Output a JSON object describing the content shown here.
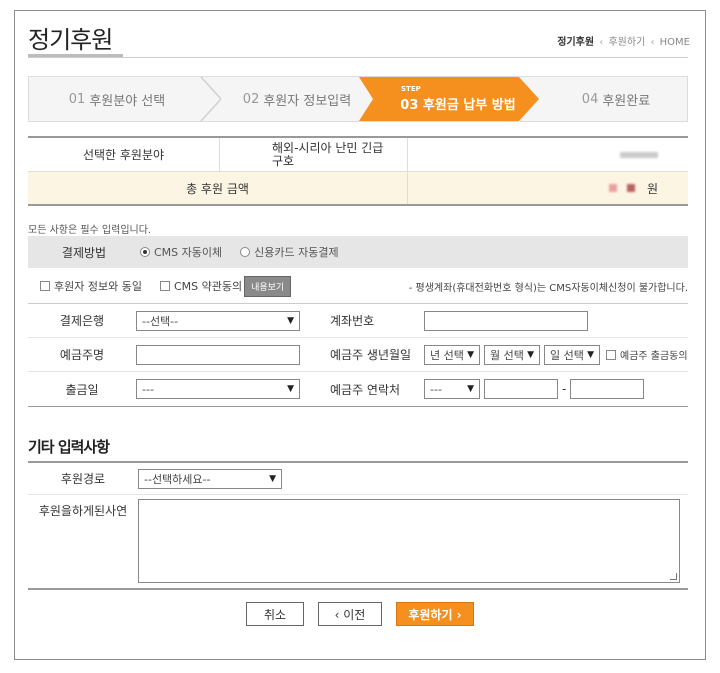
{
  "header": {
    "title": "정기후원",
    "breadcrumb": [
      "정기후원",
      "후원하기",
      "HOME"
    ]
  },
  "steps": [
    {
      "num": "01",
      "label": "후원분야 선택",
      "active": false
    },
    {
      "num": "02",
      "label": "후원자 정보입력",
      "active": false
    },
    {
      "num": "03",
      "label": "후원금 납부 방법",
      "active": true,
      "tag": "STEP"
    },
    {
      "num": "04",
      "label": "후원완료",
      "active": false
    }
  ],
  "summary": {
    "field_label": "선택한 후원분야",
    "field_value": "해외-시리아 난민 긴급구호",
    "total_label": "총 후원 금액",
    "total_unit": "원"
  },
  "form": {
    "required_note": "모든 사항은 필수 입력입니다.",
    "payment_label": "결제방법",
    "payment_options": [
      {
        "label": "CMS 자동이체",
        "selected": true
      },
      {
        "label": "신용카드 자동결제",
        "selected": false
      }
    ],
    "agree_same": "후원자 정보와 동일",
    "agree_cms": "CMS 약관동의",
    "view_button": "내용보기",
    "warning": "- 평생계좌(휴대전화번호 형식)는 CMS자동이체신청이 불가합니다.",
    "bank_label": "결제은행",
    "bank_select": "--선택--",
    "account_label": "계좌번호",
    "holder_label": "예금주명",
    "birth_label": "예금주 생년월일",
    "year_select": "년 선택",
    "month_select": "월 선택",
    "day_select": "일 선택",
    "holder_agree": "예금주 출금동의",
    "withdraw_label": "출금일",
    "withdraw_select": "---",
    "contact_label": "예금주 연락처",
    "contact_select": "---",
    "dash": "-"
  },
  "etc": {
    "title": "기타 입력사항",
    "route_label": "후원경로",
    "route_select": "--선택하세요--",
    "reason_label": "후원을하게된사연"
  },
  "buttons": {
    "cancel": "취소",
    "prev": "‹ 이전",
    "submit": "후원하기 ›"
  },
  "colors": {
    "accent": "#f5901e",
    "amount_bg": "#fdf5e4"
  }
}
